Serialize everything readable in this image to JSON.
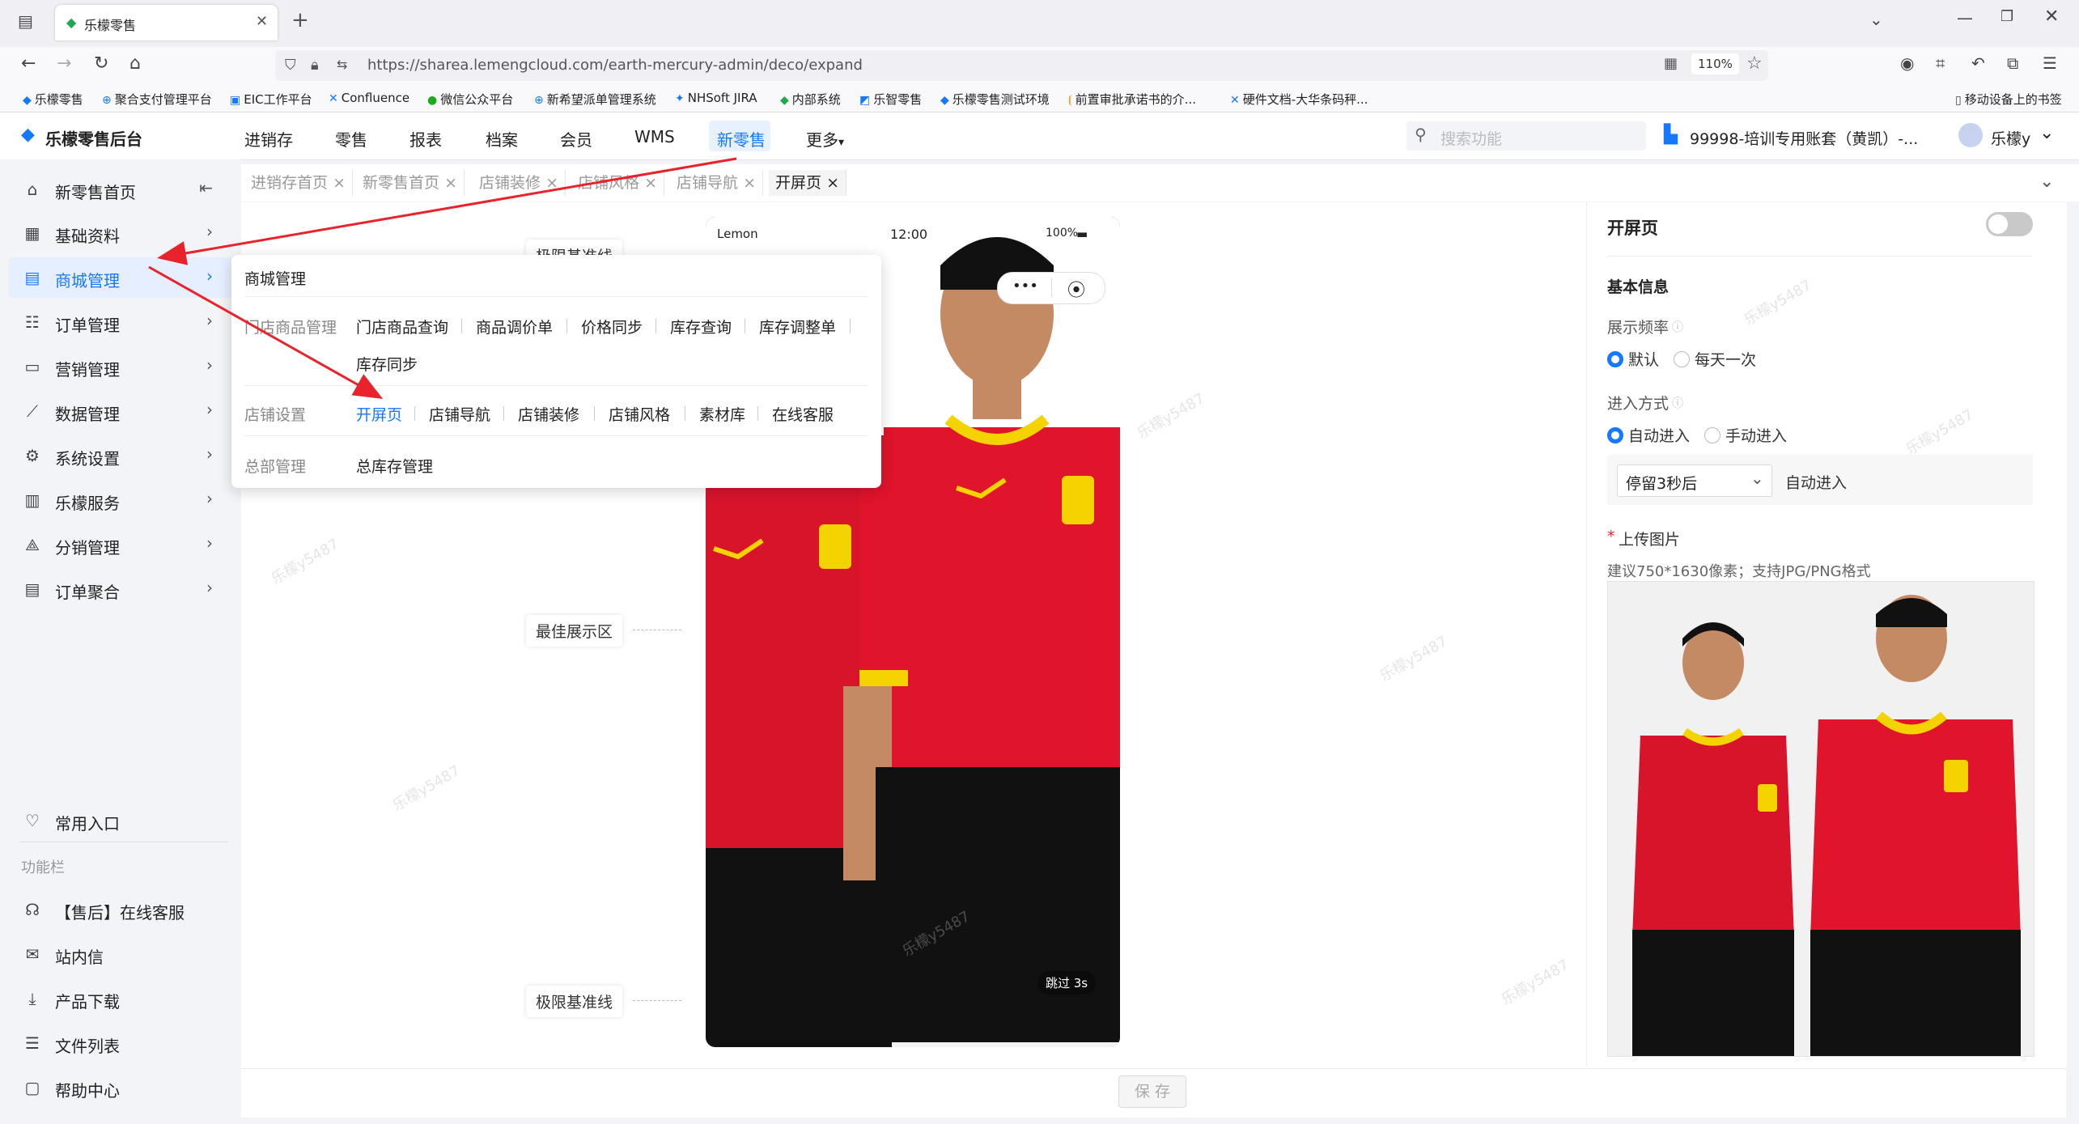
{
  "browser": {
    "tab_title": "乐檬零售",
    "url": "https://sharea.lemengcloud.com/earth-mercury-admin/deco/expand",
    "zoom": "110%",
    "bookmarks": [
      "乐檬零售",
      "聚合支付管理平台",
      "EIC工作平台",
      "Confluence",
      "微信公众平台",
      "新希望派单管理系统",
      "NHSoft JIRA",
      "内部系统",
      "乐智零售",
      "乐檬零售测试环境",
      "前置审批承诺书的介...",
      "硬件文档-大华条码秤...",
      "移动设备上的书签"
    ]
  },
  "app": {
    "logo": "乐檬零售后台",
    "nav": [
      "进销存",
      "零售",
      "报表",
      "档案",
      "会员",
      "WMS",
      "新零售",
      "更多"
    ],
    "active_nav": "新零售",
    "search_placeholder": "搜索功能",
    "account": "99998-培训专用账套（黄凯）-...",
    "user": "乐檬y"
  },
  "sidebar": {
    "items": [
      {
        "label": "新零售首页",
        "icon": "home-icon"
      },
      {
        "label": "基础资料",
        "icon": "grid-icon"
      },
      {
        "label": "商城管理",
        "icon": "shop-icon"
      },
      {
        "label": "订单管理",
        "icon": "order-icon"
      },
      {
        "label": "营销管理",
        "icon": "marketing-icon"
      },
      {
        "label": "数据管理",
        "icon": "chart-icon"
      },
      {
        "label": "系统设置",
        "icon": "settings-icon"
      },
      {
        "label": "乐檬服务",
        "icon": "service-icon"
      },
      {
        "label": "分销管理",
        "icon": "distribution-icon"
      },
      {
        "label": "订单聚合",
        "icon": "aggregate-icon"
      }
    ],
    "common_entry": "常用入口",
    "func_title": "功能栏",
    "func_items": [
      "【售后】在线客服",
      "站内信",
      "产品下载",
      "文件列表",
      "帮助中心"
    ]
  },
  "page_tabs": [
    "进销存首页",
    "新零售首页",
    "店铺装修",
    "店铺风格",
    "店铺导航",
    "开屏页"
  ],
  "dropdown": {
    "title": "商城管理",
    "row1_label": "门店商品管理",
    "row1_items": [
      "门店商品查询",
      "商品调价单",
      "价格同步",
      "库存查询",
      "库存调整单",
      "库存同步"
    ],
    "row2_label": "店铺设置",
    "row2_items": [
      "开屏页",
      "店铺导航",
      "店铺装修",
      "店铺风格",
      "素材库",
      "在线客服"
    ],
    "row3_label": "总部管理",
    "row3_items": [
      "总库存管理"
    ]
  },
  "preview": {
    "carrier": "Lemon",
    "time": "12:00",
    "battery": "100%",
    "skip": "跳过 3s",
    "guide_top": "极限基准线",
    "guide_mid": "最佳展示区",
    "guide_bottom": "极限基准线"
  },
  "panel": {
    "title": "开屏页",
    "section": "基本信息",
    "freq_label": "展示频率",
    "freq_options": [
      "默认",
      "每天一次"
    ],
    "mode_label": "进入方式",
    "mode_options": [
      "自动进入",
      "手动进入"
    ],
    "delay_select": "停留3秒后",
    "delay_suffix": "自动进入",
    "upload_label": "上传图片",
    "upload_hint": "建议750*1630像素；支持JPG/PNG格式"
  },
  "footer": {
    "save": "保 存"
  },
  "watermark": "乐檬y5487"
}
